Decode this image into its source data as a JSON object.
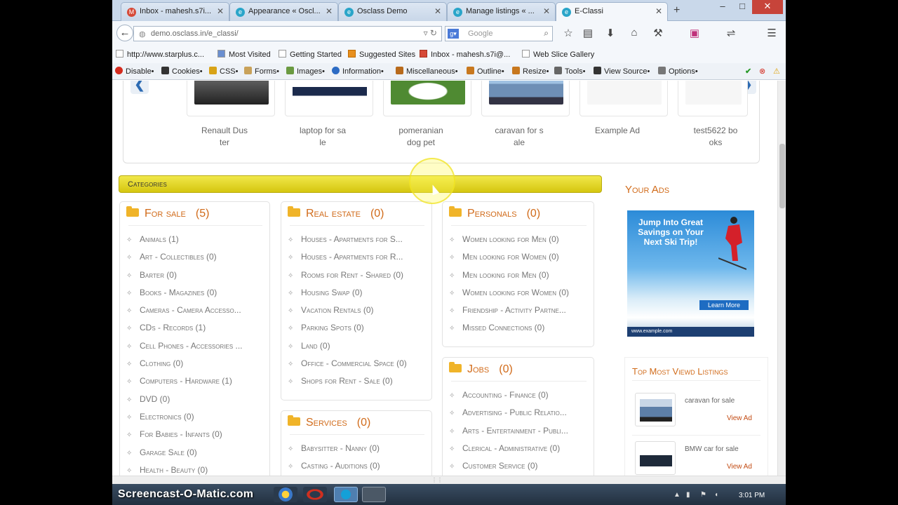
{
  "browser": {
    "tabs": [
      {
        "title": "Inbox - mahesh.s7i...",
        "icon_color": "#d64937",
        "icon": "M"
      },
      {
        "title": "Appearance « Oscl...",
        "icon_color": "#2aa5c9",
        "icon": "e"
      },
      {
        "title": "Osclass Demo",
        "icon_color": "#2aa5c9",
        "icon": "e"
      },
      {
        "title": "Manage listings « ...",
        "icon_color": "#2aa5c9",
        "icon": "e"
      },
      {
        "title": "E-Classi",
        "icon_color": "#2aa5c9",
        "icon": "e",
        "active": true
      }
    ],
    "new_tab": "+",
    "window_controls": {
      "minimize": "–",
      "maximize": "□",
      "close": "✕"
    },
    "url": "demo.osclass.in/e_classi/",
    "search_placeholder": "Google",
    "bookmarks": [
      "http://www.starplus.c...",
      "Most Visited",
      "Getting Started",
      "Suggested Sites",
      "Inbox - mahesh.s7i@...",
      "Web Slice Gallery"
    ],
    "devtools": [
      "Disable•",
      "Cookies•",
      "CSS•",
      "Forms•",
      "Images•",
      "Information•",
      "Miscellaneous•",
      "Outline•",
      "Resize•",
      "Tools•",
      "View Source•",
      "Options•"
    ]
  },
  "carousel": {
    "prev": "❮",
    "next": "❯",
    "items": [
      {
        "caption": "Renault Dus\nter",
        "color": "#2f2f2f"
      },
      {
        "caption": "laptop for sa\nle",
        "color": "#1b2a4c"
      },
      {
        "caption": "pomeranian\ndog pet",
        "color": "#4f8a32"
      },
      {
        "caption": "caravan for s\nale",
        "color": "#6e8fb6"
      },
      {
        "caption": "Example Ad",
        "color": "#f4f4f4"
      },
      {
        "caption": "test5622 bo\noks",
        "color": "#f4f4f4"
      }
    ]
  },
  "categories": {
    "title": "Categories",
    "for_sale": {
      "name": "For sale",
      "count": "(5)",
      "items": [
        "Animals (1)",
        "Art - Collectibles (0)",
        "Barter (0)",
        "Books - Magazines (0)",
        "Cameras - Camera Accesso...",
        "CDs - Records (1)",
        "Cell Phones - Accessories ...",
        "Clothing (0)",
        "Computers - Hardware (1)",
        "DVD (0)",
        "Electronics (0)",
        "For Babies - Infants (0)",
        "Garage Sale (0)",
        "Health - Beauty (0)"
      ]
    },
    "real_estate": {
      "name": "Real estate",
      "count": "(0)",
      "items": [
        "Houses - Apartments for S...",
        "Houses - Apartments for R...",
        "Rooms for Rent - Shared (0)",
        "Housing Swap (0)",
        "Vacation Rentals (0)",
        "Parking Spots (0)",
        "Land (0)",
        "Office - Commercial Space (0)",
        "Shops for Rent - Sale (0)"
      ]
    },
    "personals": {
      "name": "Personals",
      "count": "(0)",
      "items": [
        "Women looking for Men (0)",
        "Men looking for Women (0)",
        "Men looking for Men (0)",
        "Women looking for Women (0)",
        "Friendship - Activity Partne...",
        "Missed Connections (0)"
      ]
    },
    "services": {
      "name": "Services",
      "count": "(0)",
      "items": [
        "Babysitter - Nanny (0)",
        "Casting - Auditions (0)"
      ]
    },
    "jobs": {
      "name": "Jobs",
      "count": "(0)",
      "items": [
        "Accounting - Finance (0)",
        "Advertising - Public Relatio...",
        "Arts - Entertainment - Publi...",
        "Clerical - Administrative (0)",
        "Customer Service (0)"
      ]
    }
  },
  "sidebar": {
    "your_ads": "Your Ads",
    "ad": {
      "headline": "Jump Into Great Savings on Your Next Ski Trip!",
      "cta": "Learn More",
      "footer": "www.example.com"
    },
    "top_viewed": {
      "title": "Top Most Viewd Listings",
      "items": [
        {
          "title": "caravan for sale",
          "link": "View Ad",
          "color": "#5d7fa8"
        },
        {
          "title": "BMW car for sale",
          "link": "View Ad",
          "color": "#1e2a3a"
        }
      ]
    }
  },
  "taskbar": {
    "watermark": "Screencast-O-Matic.com",
    "clock": "3:01 PM",
    "apps": [
      "#3a78c9",
      "#d02f1f",
      "#14a0d8",
      "#555555"
    ]
  }
}
